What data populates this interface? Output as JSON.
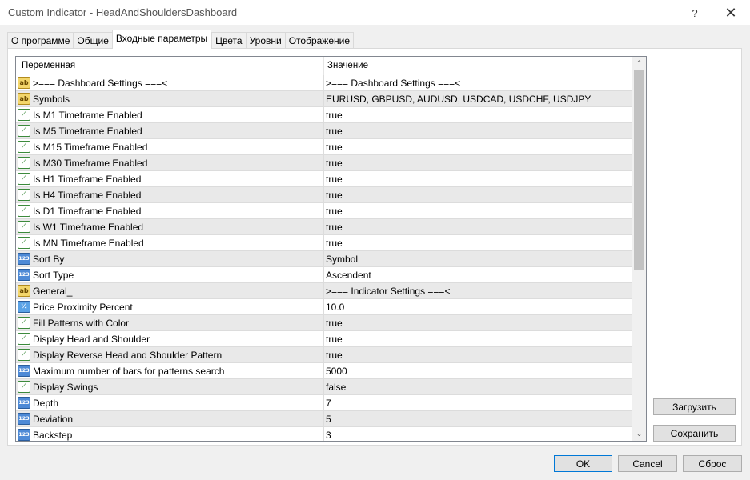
{
  "window": {
    "title": "Custom Indicator - HeadAndShouldersDashboard",
    "help_glyph": "?",
    "close_glyph": "✕"
  },
  "tabs": [
    {
      "label": "О программе"
    },
    {
      "label": "Общие"
    },
    {
      "label": "Входные параметры",
      "active": true
    },
    {
      "label": "Цвета"
    },
    {
      "label": "Уровни"
    },
    {
      "label": "Отображение"
    }
  ],
  "grid": {
    "col_variable": "Переменная",
    "col_value": "Значение",
    "rows": [
      {
        "type": "ab",
        "icon_text": "ab",
        "name": ">=== Dashboard Settings ===<",
        "value": ">=== Dashboard Settings ===<"
      },
      {
        "type": "ab",
        "icon_text": "ab",
        "name": "Symbols",
        "value": "EURUSD, GBPUSD, AUDUSD, USDCAD, USDCHF, USDJPY"
      },
      {
        "type": "bool",
        "icon_text": "⟋",
        "name": "Is M1 Timeframe Enabled",
        "value": "true"
      },
      {
        "type": "bool",
        "icon_text": "⟋",
        "name": "Is M5 Timeframe Enabled",
        "value": "true"
      },
      {
        "type": "bool",
        "icon_text": "⟋",
        "name": "Is M15 Timeframe Enabled",
        "value": "true"
      },
      {
        "type": "bool",
        "icon_text": "⟋",
        "name": "Is M30 Timeframe Enabled",
        "value": "true"
      },
      {
        "type": "bool",
        "icon_text": "⟋",
        "name": "Is H1 Timeframe Enabled",
        "value": "true"
      },
      {
        "type": "bool",
        "icon_text": "⟋",
        "name": "Is H4 Timeframe Enabled",
        "value": "true"
      },
      {
        "type": "bool",
        "icon_text": "⟋",
        "name": "Is D1 Timeframe Enabled",
        "value": "true"
      },
      {
        "type": "bool",
        "icon_text": "⟋",
        "name": "Is W1 Timeframe Enabled",
        "value": "true"
      },
      {
        "type": "bool",
        "icon_text": "⟋",
        "name": "Is MN Timeframe Enabled",
        "value": "true"
      },
      {
        "type": "int",
        "icon_text": "123",
        "name": "Sort By",
        "value": "Symbol"
      },
      {
        "type": "int",
        "icon_text": "123",
        "name": "Sort Type",
        "value": "Ascendent"
      },
      {
        "type": "ab",
        "icon_text": "ab",
        "name": "General_",
        "value": ">=== Indicator Settings ===<"
      },
      {
        "type": "dbl",
        "icon_text": "½",
        "name": "Price Proximity Percent",
        "value": "10.0"
      },
      {
        "type": "bool",
        "icon_text": "⟋",
        "name": "Fill Patterns with Color",
        "value": "true"
      },
      {
        "type": "bool",
        "icon_text": "⟋",
        "name": "Display Head and Shoulder",
        "value": "true"
      },
      {
        "type": "bool",
        "icon_text": "⟋",
        "name": "Display Reverse Head and Shoulder Pattern",
        "value": "true"
      },
      {
        "type": "int",
        "icon_text": "123",
        "name": "Maximum number of bars for patterns search",
        "value": "5000"
      },
      {
        "type": "bool",
        "icon_text": "⟋",
        "name": "Display Swings",
        "value": "false"
      },
      {
        "type": "int",
        "icon_text": "123",
        "name": "Depth",
        "value": "7"
      },
      {
        "type": "int",
        "icon_text": "123",
        "name": "Deviation",
        "value": "5"
      },
      {
        "type": "int",
        "icon_text": "123",
        "name": "Backstep",
        "value": "3"
      }
    ]
  },
  "scrollbar": {
    "up_glyph": "⌃",
    "down_glyph": "⌄"
  },
  "buttons": {
    "load": "Загрузить",
    "save": "Сохранить",
    "ok": "OK",
    "cancel": "Cancel",
    "reset": "Сброс"
  }
}
